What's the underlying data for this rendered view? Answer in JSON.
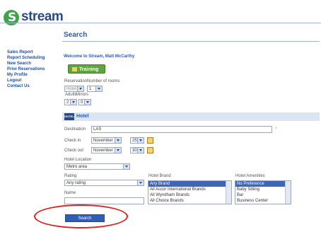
{
  "brand": {
    "name": "stream",
    "logo_letter": "S"
  },
  "page": {
    "title": "Search"
  },
  "sidebar": {
    "items": [
      {
        "label": "Sales Report"
      },
      {
        "label": "Report Scheduling"
      },
      {
        "label": "New Search"
      },
      {
        "label": "Prior Reservations"
      },
      {
        "label": "My Profile"
      },
      {
        "label": "Logout"
      },
      {
        "label": "Contact Us"
      }
    ]
  },
  "welcome": "Welcome to Stream, Matt McCarthy",
  "training_label": "Training",
  "reservation": {
    "label": "Reservation",
    "rooms_label": "Number of rooms",
    "type_value": "Hotel",
    "rooms_value": "1",
    "adults_label": "Adults",
    "minors_label": "Minors",
    "adults_value": "2",
    "minors_value": "0"
  },
  "hotel": {
    "title": "Hotel",
    "icon_text": "HOTEL",
    "destination_label": "Destination",
    "destination_value": "LAS",
    "required_mark": "*",
    "checkin_label": "Check in",
    "checkin_month": "November",
    "checkin_day": "25",
    "checkout_label": "Check out",
    "checkout_month": "November",
    "checkout_day": "30",
    "location_label": "Hotel Location",
    "location_value": "Metro area",
    "rating_label": "Rating",
    "rating_value": "Any rating",
    "name_label": "Name",
    "brand_label": "Hotel Brand",
    "brand_options": [
      {
        "label": "Any Brand",
        "selected": true
      },
      {
        "label": "All Accor International Brands",
        "selected": false
      },
      {
        "label": "All Wyndham Brands",
        "selected": false
      },
      {
        "label": "All Choice Brands",
        "selected": false
      }
    ],
    "amenities_label": "Hotel Amenities",
    "amenity_options": [
      {
        "label": "No Preference",
        "selected": true
      },
      {
        "label": "Baby Sitting",
        "selected": false
      },
      {
        "label": "Bar",
        "selected": false
      },
      {
        "label": "Business Center",
        "selected": false
      }
    ]
  },
  "search_button": "Search",
  "colors": {
    "brand_blue": "#2b4b7f",
    "link_blue": "#1f4e9c",
    "training_green": "#5ea63c",
    "highlight_red": "#e02020"
  }
}
